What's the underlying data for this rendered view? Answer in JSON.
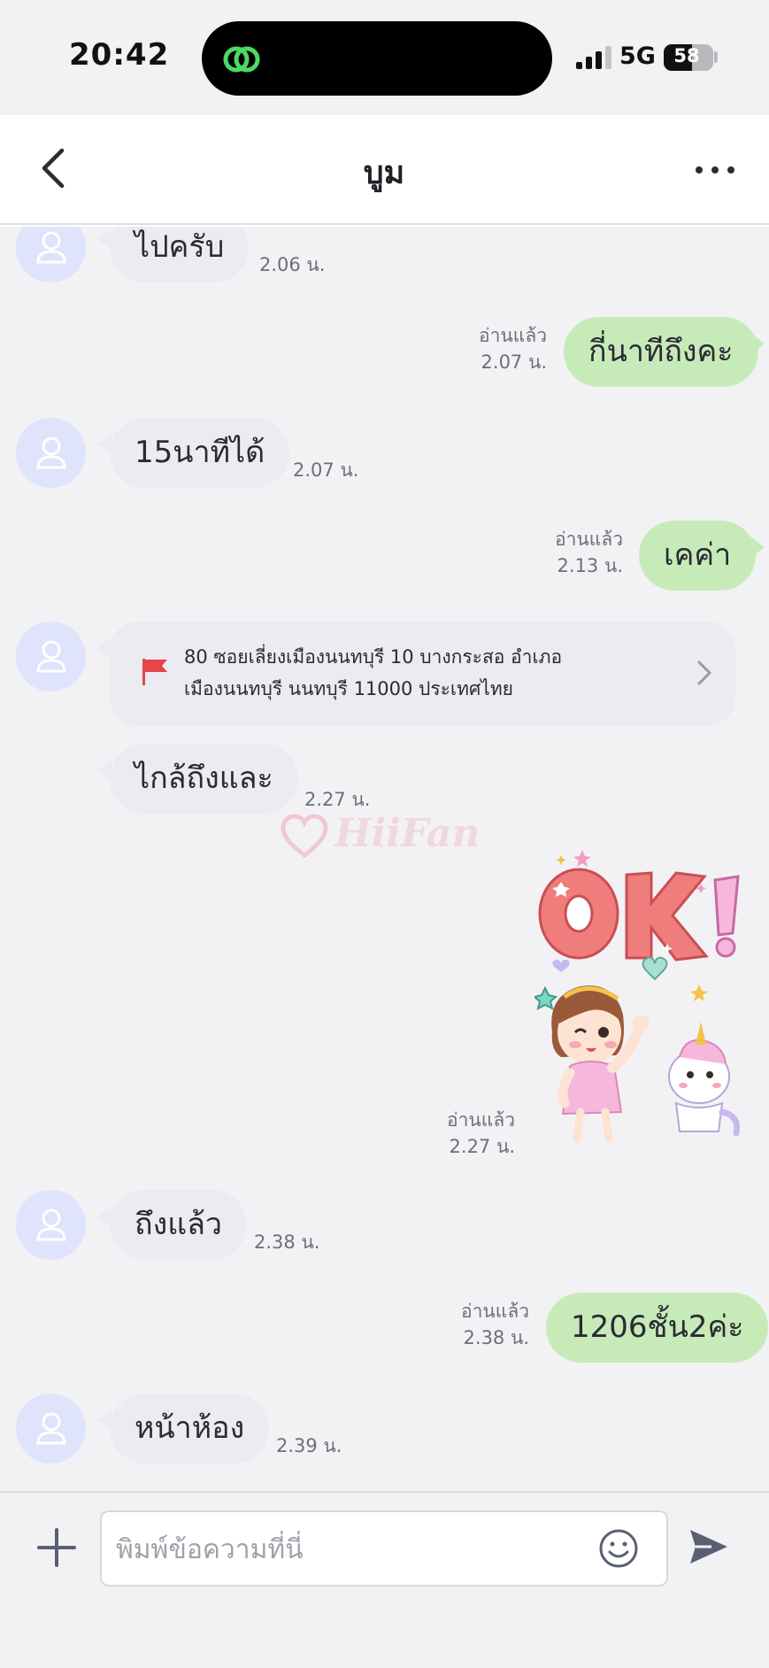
{
  "status_bar": {
    "time": "20:42",
    "network": "5G",
    "battery_percent": "58",
    "battery_level": 0.58,
    "signal_bars": 3,
    "signal_bars_max": 4
  },
  "header": {
    "back_icon": "chevron-left-icon",
    "title": "บูม",
    "more_icon": "ellipsis-icon"
  },
  "messages": [
    {
      "side": "in",
      "text": "ไปครับ",
      "time": "2.06 น."
    },
    {
      "side": "out",
      "text": "กี่นาทีถึงคะ",
      "read": "อ่านแล้ว",
      "time": "2.07 น."
    },
    {
      "side": "in",
      "text": "15นาทีได้",
      "time": "2.07 น."
    },
    {
      "side": "out",
      "text": "เคค่า",
      "read": "อ่านแล้ว",
      "time": "2.13 น."
    },
    {
      "side": "in",
      "type": "location",
      "line1": "80 ซอยเลี่ยงเมืองนนทบุรี 10 บางกระสอ อำเภอ",
      "line2": "เมืองนนทบุรี นนทบุรี 11000 ประเทศไทย"
    },
    {
      "side": "in",
      "text": "ไกล้ถึงและ",
      "time": "2.27 น."
    },
    {
      "side": "out",
      "type": "sticker",
      "sticker_text": "OK!",
      "read": "อ่านแล้ว",
      "time": "2.27 น."
    },
    {
      "side": "in",
      "text": "ถึงแล้ว",
      "time": "2.38 น."
    },
    {
      "side": "out",
      "text": "1206ชั้น2ค่ะ",
      "read": "อ่านแล้ว",
      "time": "2.38 น."
    },
    {
      "side": "in",
      "text": "หน้าห้อง",
      "time": "2.39 น."
    }
  ],
  "watermark": {
    "text": "HiiFan"
  },
  "input_bar": {
    "placeholder": "พิมพ์ข้อความที่นี่",
    "plus_icon": "plus-icon",
    "emoji_icon": "smiley-icon",
    "send_icon": "send-icon"
  },
  "colors": {
    "incoming_bubble": "#ebebf1",
    "outgoing_bubble": "#c6ebb9",
    "chat_background": "#f2f2f5",
    "avatar_background": "#dfe3fb",
    "flag_red": "#e8434a",
    "accent_green": "#4cd964"
  }
}
